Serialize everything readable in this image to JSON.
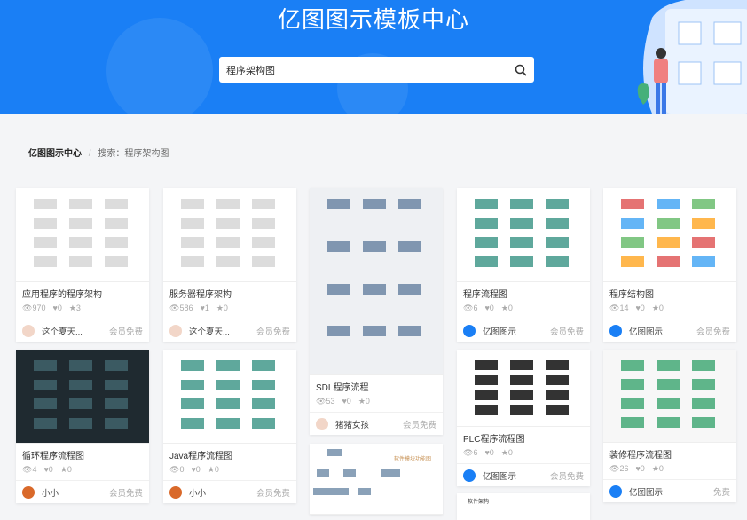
{
  "header": {
    "title": "亿图图示模板中心",
    "search_value": "程序架构图"
  },
  "breadcrumb": {
    "home": "亿图图示中心",
    "separator": "/",
    "current": "搜索：程序架构图"
  },
  "cards": [
    {
      "title": "应用程序的程序架构",
      "views": "970",
      "likes": "0",
      "stars": "3",
      "author": "这个夏天...",
      "price": "会员免费",
      "theme": "gray"
    },
    {
      "title": "服务器程序架构",
      "views": "586",
      "likes": "1",
      "stars": "0",
      "author": "这个夏天...",
      "price": "会员免费",
      "theme": "gray"
    },
    {
      "title": "SDL程序流程",
      "views": "53",
      "likes": "0",
      "stars": "0",
      "author": "猪猪女孩",
      "price": "会员免费",
      "theme": "sdl"
    },
    {
      "title": "程序流程图",
      "views": "6",
      "likes": "0",
      "stars": "0",
      "author": "亿图图示",
      "price": "会员免费",
      "theme": "teal"
    },
    {
      "title": "程序结构图",
      "views": "14",
      "likes": "0",
      "stars": "0",
      "author": "亿图图示",
      "price": "会员免费",
      "theme": "color"
    },
    {
      "title": "循环程序流程图",
      "views": "4",
      "likes": "0",
      "stars": "0",
      "author": "小小",
      "price": "会员免费",
      "theme": "dark"
    },
    {
      "title": "Java程序流程图",
      "views": "0",
      "likes": "0",
      "stars": "0",
      "author": "小小",
      "price": "会员免费",
      "theme": "teal"
    },
    {
      "title": "PLC程序流程图",
      "views": "6",
      "likes": "0",
      "stars": "0",
      "author": "亿图图示",
      "price": "会员免费",
      "theme": "plc"
    },
    {
      "title": "装修程序流程图",
      "views": "26",
      "likes": "0",
      "stars": "0",
      "author": "亿图图示",
      "price": "免费",
      "theme": "green"
    }
  ],
  "partial_cards": [
    {
      "thumb_label": "软件模块功能图"
    },
    {
      "thumb_label": "软件架构"
    }
  ],
  "colors": {
    "brand": "#1a7ff5"
  }
}
